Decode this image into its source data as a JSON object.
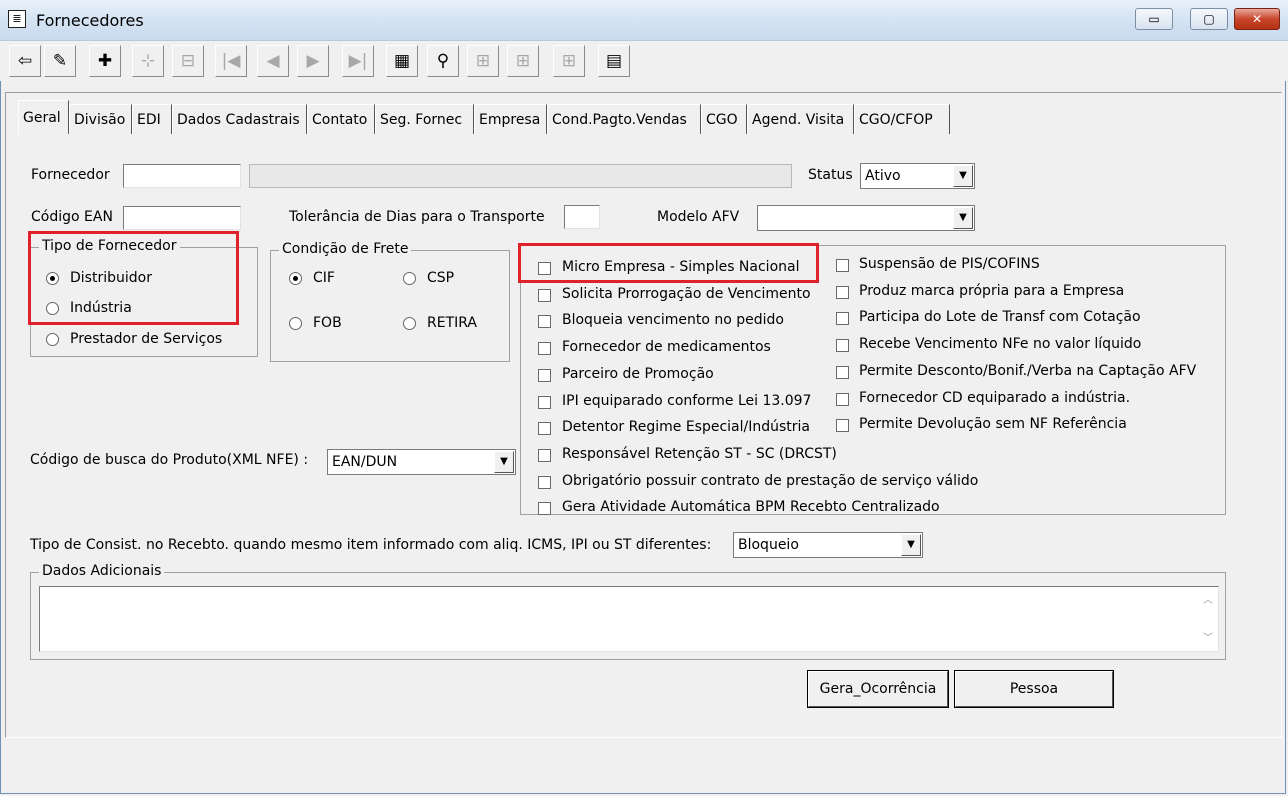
{
  "window": {
    "title": "Fornecedores",
    "minimize": "▭",
    "maximize": "▢",
    "close": "✕"
  },
  "toolbar": {
    "icons": [
      "exit-icon",
      "eraser-icon",
      "add-icon",
      "first-record-icon",
      "prev-page-icon",
      "first-icon",
      "prev-icon",
      "next-icon",
      "last-icon",
      "grid-icon",
      "binoculars-icon",
      "filter-icon",
      "filter2-icon",
      "filter3-icon",
      "spreadsheet-icon"
    ],
    "glyphs": [
      "⇦",
      "✎",
      "✚",
      "⊹",
      "⊟",
      "|◀",
      "◀",
      "▶",
      "▶|",
      "▦",
      "⚲",
      "⊞",
      "⊞",
      "⊞",
      "▤"
    ]
  },
  "tabs": [
    "Geral",
    "Divisão",
    "EDI",
    "Dados Cadastrais",
    "Contato",
    "Seg. Fornec",
    "Empresa",
    "Cond.Pagto.Vendas",
    "CGO",
    "Agend. Visita",
    "CGO/CFOP"
  ],
  "form": {
    "fornecedor_label": "Fornecedor",
    "fornecedor_code": "",
    "fornecedor_name": "",
    "status_label": "Status",
    "status_value": "Ativo",
    "ean_label": "Código EAN",
    "ean_value": "",
    "tolerancia_label": "Tolerância de Dias para o Transporte",
    "tolerancia_value": "",
    "modelo_afv_label": "Modelo AFV",
    "modelo_afv_value": "",
    "busca_label": "Código de busca do Produto(XML NFE) :",
    "busca_value": "EAN/DUN",
    "consist_label": "Tipo de Consist. no Recebto. quando mesmo item informado com aliq. ICMS, IPI ou ST diferentes:",
    "consist_value": "Bloqueio",
    "dados_adicionais_label": "Dados Adicionais",
    "dados_adicionais_value": ""
  },
  "tipo_fornecedor": {
    "caption": "Tipo de Fornecedor",
    "options": [
      "Distribuidor",
      "Indústria",
      "Prestador de Serviços"
    ],
    "selected": "Distribuidor"
  },
  "condicao_frete": {
    "caption": "Condição de Frete",
    "options": [
      "CIF",
      "CSP",
      "FOB",
      "RETIRA"
    ],
    "selected": "CIF"
  },
  "checks_left": [
    "Micro Empresa - Simples Nacional",
    "Solicita Prorrogação de Vencimento",
    "Bloqueia vencimento no pedido",
    "Fornecedor de medicamentos",
    "Parceiro de Promoção",
    "IPI equiparado conforme Lei 13.097",
    "Detentor Regime Especial/Indústria",
    "Responsável Retenção ST - SC (DRCST)",
    "Obrigatório possuir contrato de prestação de serviço válido",
    "Gera Atividade Automática BPM Recebto Centralizado"
  ],
  "checks_right": [
    "Suspensão de PIS/COFINS",
    "Produz marca própria para a Empresa",
    "Participa do Lote de Transf com Cotação",
    "Recebe Vencimento NFe no valor líquido",
    "Permite Desconto/Bonif./Verba na Captação AFV",
    "Fornecedor CD equiparado a indústria.",
    "Permite Devolução sem NF Referência"
  ],
  "buttons": {
    "gera_ocorrencia": "Gera_Ocorrência",
    "pessoa": "Pessoa"
  },
  "colors": {
    "highlight": "#e0202a",
    "window_bg": "#f0f0f0"
  }
}
